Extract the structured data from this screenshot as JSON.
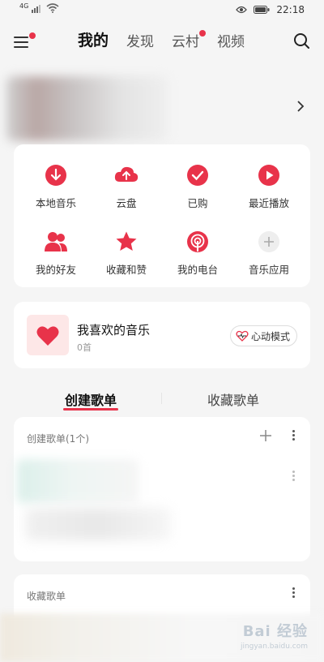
{
  "status_bar": {
    "network": "4G",
    "time": "22:18"
  },
  "top_nav": {
    "tabs": [
      {
        "label": "我的",
        "active": true
      },
      {
        "label": "发现",
        "active": false
      },
      {
        "label": "云村",
        "active": false,
        "badge": true
      },
      {
        "label": "视频",
        "active": false
      }
    ]
  },
  "quick_grid": {
    "items": [
      {
        "label": "本地音乐",
        "icon": "download-icon"
      },
      {
        "label": "云盘",
        "icon": "cloud-upload-icon"
      },
      {
        "label": "已购",
        "icon": "check-icon"
      },
      {
        "label": "最近播放",
        "icon": "play-icon"
      },
      {
        "label": "我的好友",
        "icon": "friends-icon"
      },
      {
        "label": "收藏和赞",
        "icon": "star-icon"
      },
      {
        "label": "我的电台",
        "icon": "radio-icon"
      },
      {
        "label": "音乐应用",
        "icon": "plus-icon"
      }
    ]
  },
  "liked_music": {
    "title": "我喜欢的音乐",
    "count": "0首",
    "heart_mode_label": "心动模式"
  },
  "playlist_tabs": [
    {
      "label": "创建歌单",
      "active": true
    },
    {
      "label": "收藏歌单",
      "active": false
    }
  ],
  "created_section": {
    "header": "创建歌单(1个)"
  },
  "collected_section": {
    "header": "收藏歌单"
  },
  "watermark": {
    "text": "Bai 经验",
    "sub": "jingyan.baidu.com"
  },
  "colors": {
    "accent": "#e8334a",
    "background": "#f5f5f5",
    "card": "#ffffff"
  }
}
